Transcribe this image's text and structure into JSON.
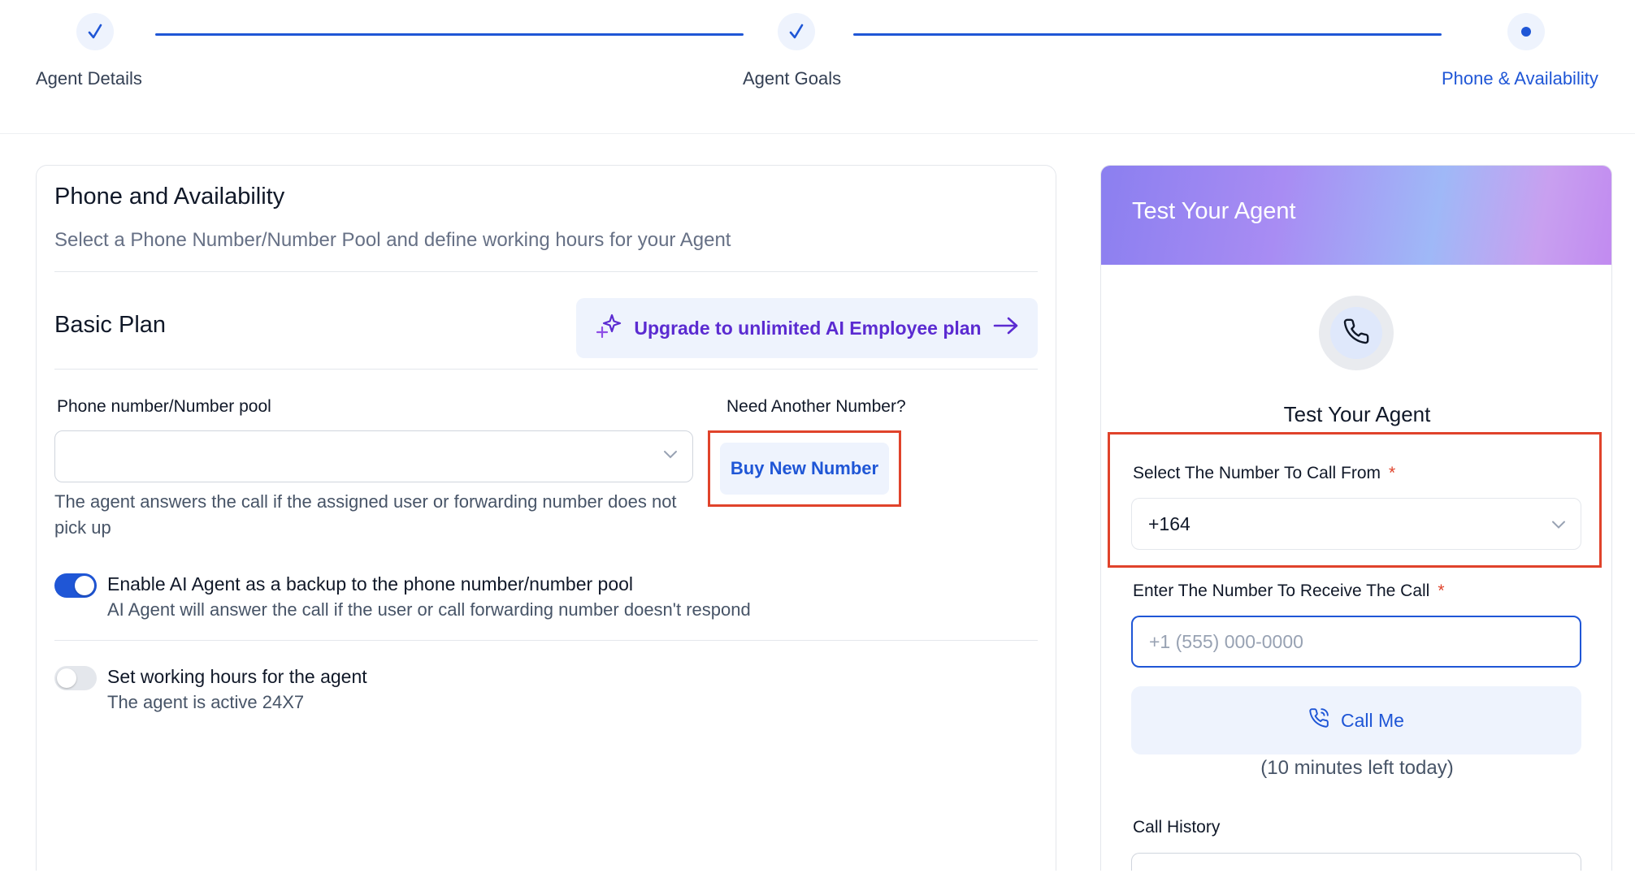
{
  "stepper": {
    "steps": [
      {
        "label": "Agent Details",
        "state": "done"
      },
      {
        "label": "Agent Goals",
        "state": "done"
      },
      {
        "label": "Phone & Availability",
        "state": "active"
      }
    ]
  },
  "main": {
    "title": "Phone and Availability",
    "subtitle": "Select a Phone Number/Number Pool and define working hours for your Agent",
    "plan_name": "Basic Plan",
    "upgrade_label": "Upgrade to unlimited AI Employee plan",
    "phone_pool_label": "Phone number/Number pool",
    "phone_pool_value": "",
    "need_number_label": "Need Another Number?",
    "buy_button": "Buy New Number",
    "help_text": "The agent answers the call if the assigned user or forwarding number does not pick up",
    "backup_toggle": {
      "title": "Enable AI Agent as a backup to the phone number/number pool",
      "description": "AI Agent will answer the call if the user or call forwarding number doesn't respond",
      "enabled": true
    },
    "hours_toggle": {
      "title": "Set working hours for the agent",
      "description": "The agent is active 24X7",
      "enabled": false
    }
  },
  "test_panel": {
    "header": "Test Your Agent",
    "title": "Test Your Agent",
    "from_label": "Select The Number To Call From",
    "from_value": "+164",
    "to_label": "Enter The Number To Receive The Call",
    "to_placeholder": "+1 (555) 000-0000",
    "required_mark": "*",
    "call_button": "Call Me",
    "minutes_left": "(10 minutes left today)",
    "history_label": "Call History"
  },
  "colors": {
    "primary": "#1f56d6",
    "upgrade_purple": "#5b2bd1",
    "highlight_red": "#e0432b"
  }
}
